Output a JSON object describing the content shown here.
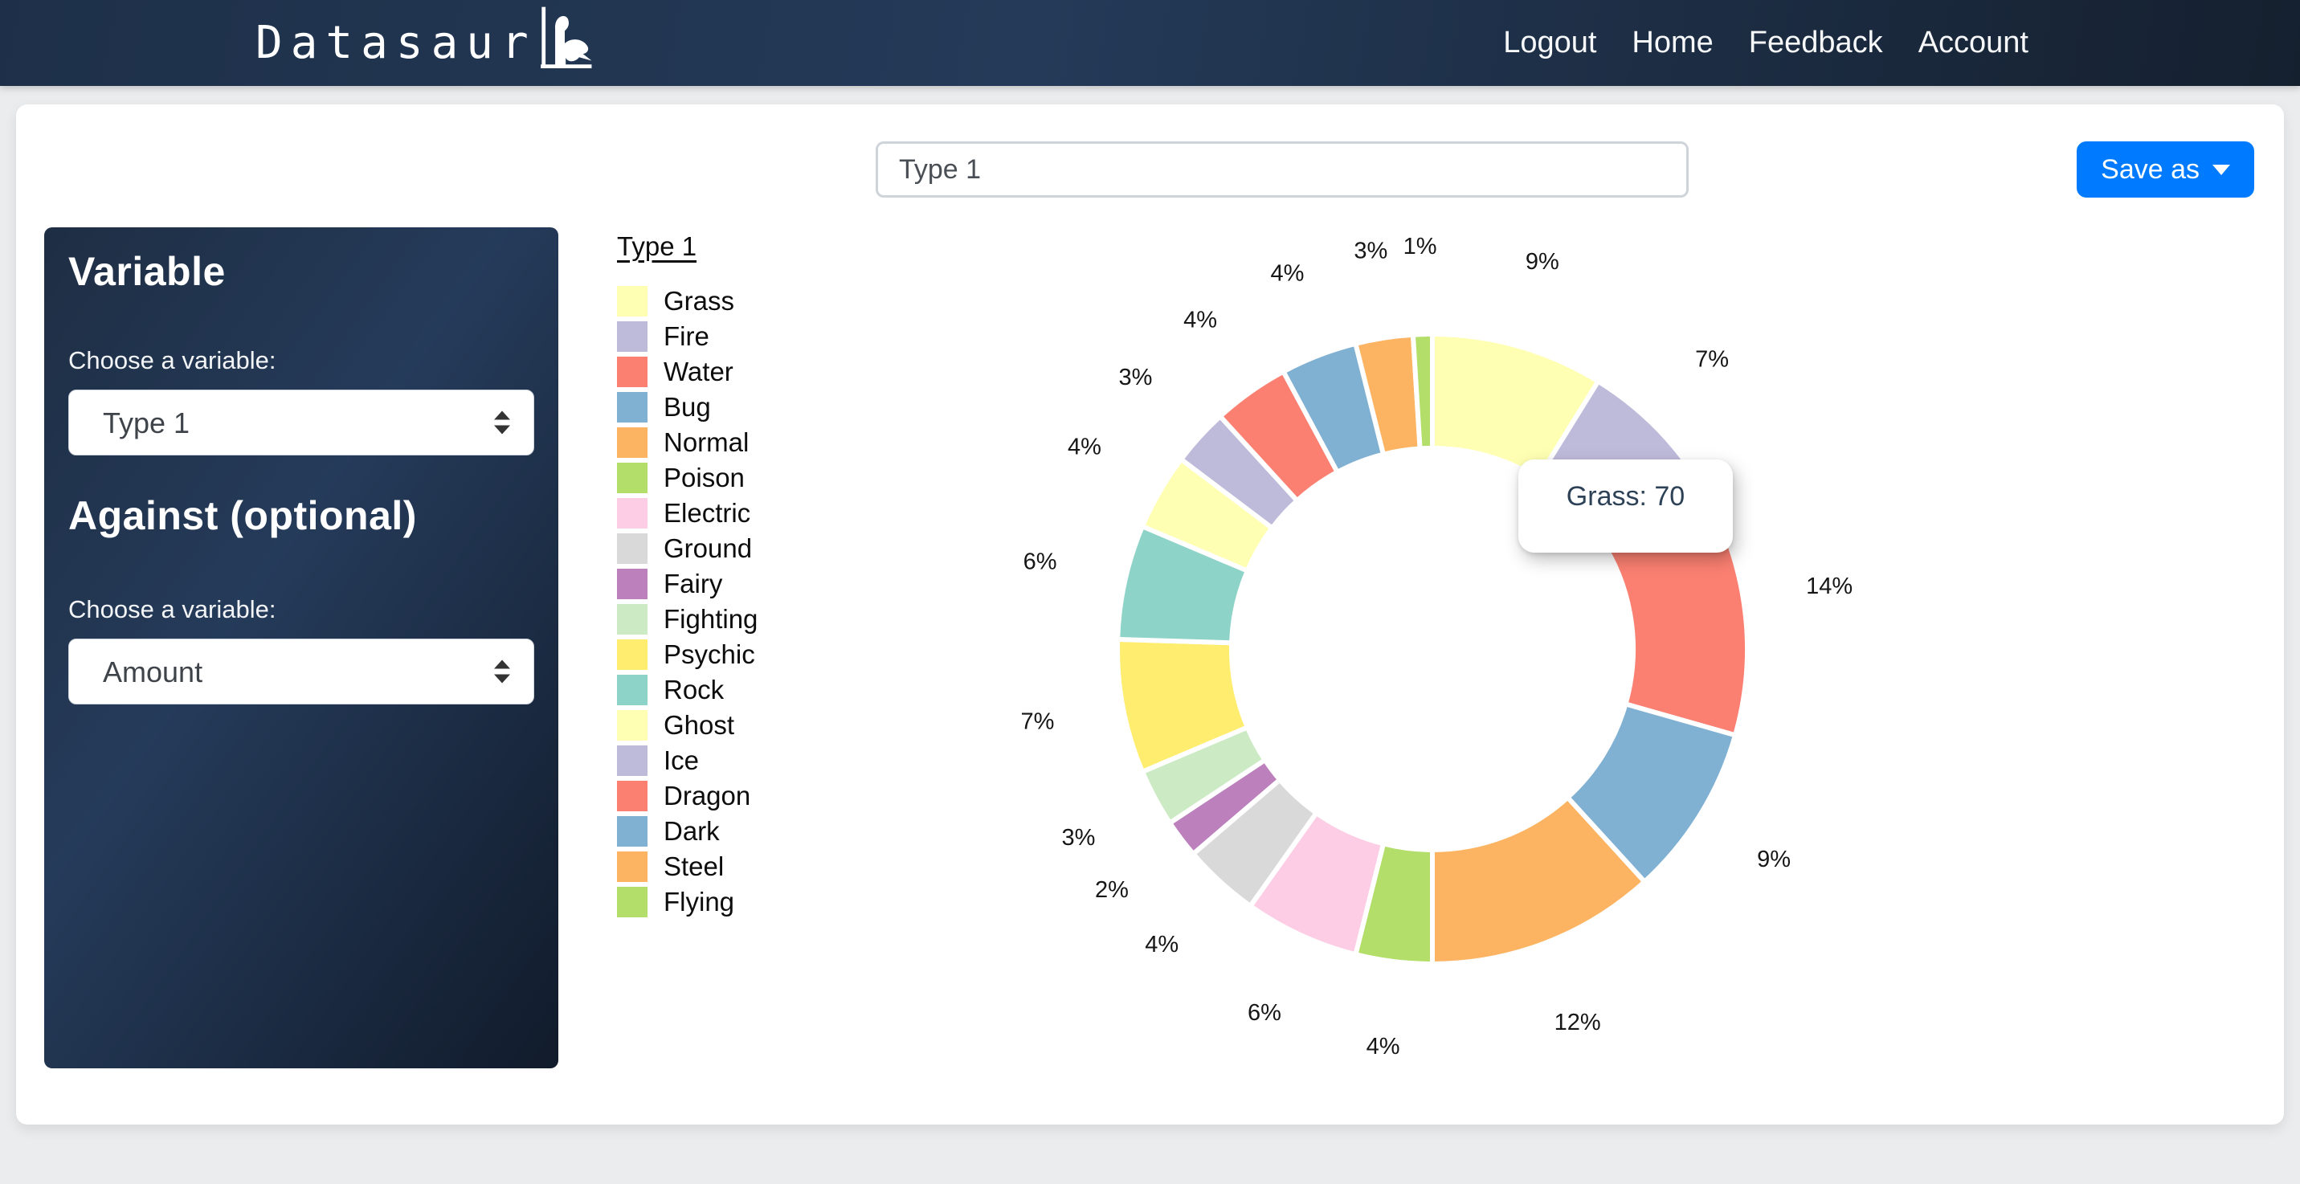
{
  "header": {
    "brand": "Datasaur",
    "nav": [
      {
        "label": "Logout"
      },
      {
        "label": "Home"
      },
      {
        "label": "Feedback"
      },
      {
        "label": "Account"
      }
    ]
  },
  "toolbar": {
    "chart_name_input": {
      "value": "Type 1"
    },
    "save_as_label": "Save as"
  },
  "sidebar": {
    "variable_heading": "Variable",
    "variable_label": "Choose a variable:",
    "variable_select": {
      "selected": "Type 1"
    },
    "against_heading": "Against (optional)",
    "against_label": "Choose a variable:",
    "against_select": {
      "selected": "Amount"
    }
  },
  "tooltip": {
    "text": "Grass: 70",
    "category": "Grass",
    "value": 70
  },
  "chart_data": {
    "type": "pie",
    "donut": true,
    "title": "Type 1",
    "legend_position": "left",
    "start": "top",
    "direction": "clockwise",
    "cutout_ratio": 0.64,
    "categories": [
      "Grass",
      "Fire",
      "Water",
      "Bug",
      "Normal",
      "Poison",
      "Electric",
      "Ground",
      "Fairy",
      "Fighting",
      "Psychic",
      "Rock",
      "Ghost",
      "Ice",
      "Dragon",
      "Dark",
      "Steel",
      "Flying"
    ],
    "percent_values": [
      9,
      7,
      14,
      9,
      12,
      4,
      6,
      4,
      2,
      3,
      7,
      6,
      4,
      3,
      4,
      4,
      3,
      1
    ],
    "percent_labels": [
      "9%",
      "7%",
      "14%",
      "9%",
      "12%",
      "4%",
      "6%",
      "4%",
      "2%",
      "3%",
      "7%",
      "6%",
      "4%",
      "3%",
      "4%",
      "4%",
      "3%",
      "1%"
    ],
    "colors": [
      "#ffffb3",
      "#bebada",
      "#fb8072",
      "#80b1d3",
      "#fdb462",
      "#b3de69",
      "#fccde5",
      "#d9d9d9",
      "#bc80bd",
      "#ccebc5",
      "#ffed6f",
      "#8dd3c7",
      "#ffffb3",
      "#bebada",
      "#fb8072",
      "#80b1d3",
      "#fdb462",
      "#b3de69"
    ],
    "slice_border_color": "#ffffff",
    "tooltip_shown": {
      "category": "Grass",
      "value": 70
    }
  }
}
